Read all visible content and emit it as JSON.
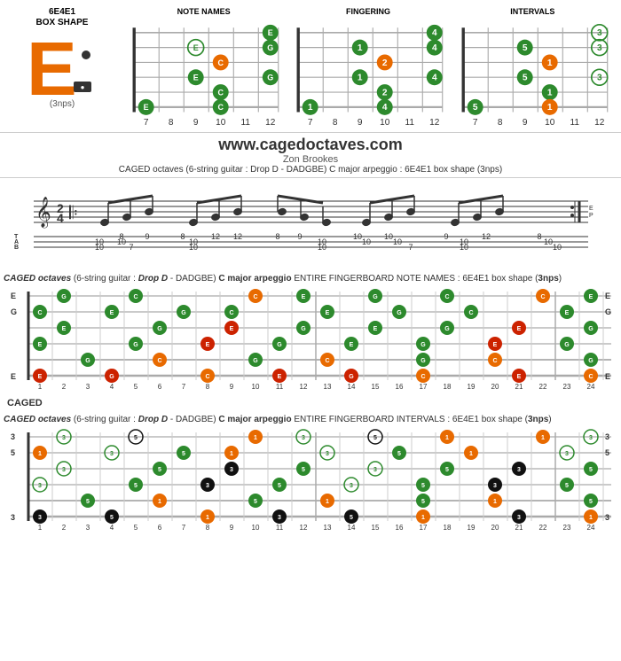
{
  "header": {
    "box_shape_title": "6E4E1",
    "box_shape_subtitle": "BOX SHAPE",
    "e_letter": "E",
    "nps_label": "(3nps)",
    "dot_indicator": "●"
  },
  "diagrams": [
    {
      "title": "NOTE NAMES",
      "notes": [
        "E",
        "G",
        "C",
        "E",
        "G",
        "E",
        "C"
      ]
    },
    {
      "title": "FINGERING",
      "notes": [
        "1",
        "2",
        "4",
        "1",
        "2",
        "4"
      ]
    },
    {
      "title": "INTERVALS",
      "notes": [
        "1",
        "3",
        "5",
        "1",
        "3",
        "5"
      ]
    }
  ],
  "fret_numbers_mini": [
    7,
    8,
    9,
    10,
    11,
    12
  ],
  "fret_numbers_full": [
    1,
    2,
    3,
    4,
    5,
    6,
    7,
    8,
    9,
    10,
    11,
    12,
    13,
    14,
    15,
    16,
    17,
    18,
    19,
    20,
    21,
    22,
    23,
    24
  ],
  "website": {
    "url": "www.cagedoctaves.com",
    "author": "Zon Brookes",
    "description": "CAGED octaves (6-string guitar : Drop D - DADGBE) C major arpeggio : 6E4E1 box shape (3nps)"
  },
  "sections": {
    "note_names": {
      "label_italic": "CAGED octaves",
      "label_normal": " (6-string guitar : Drop D - DADGBE) ",
      "label_bold": "C major arpeggio",
      "label_end": " ENTIRE FINGERBOARD NOTE NAMES : 6E4E1 box shape (3nps)",
      "string_labels_left": [
        "E",
        "G",
        "",
        "",
        "",
        "E"
      ],
      "string_labels_right": [
        "E",
        "G",
        "",
        "",
        "",
        "E"
      ]
    },
    "intervals": {
      "label_italic": "CAGED octaves",
      "label_normal": " (6-string guitar : Drop D - DADGBE) ",
      "label_bold": "C major arpeggio",
      "label_end": " ENTIRE FINGERBOARD INTERVALS : 6E4E1 box shape (3nps)",
      "string_labels_left": [
        "3",
        "5",
        "",
        "",
        "",
        "3"
      ],
      "string_labels_right": [
        "3",
        "5",
        "",
        "",
        "",
        "3"
      ]
    }
  },
  "colors": {
    "orange": "#E86A00",
    "green": "#2D8A2D",
    "red": "#CC2200",
    "black": "#111111",
    "white": "#FFFFFF",
    "yellow_green": "#8DB600",
    "dark_green": "#006400"
  },
  "caged_label": "CAGED"
}
